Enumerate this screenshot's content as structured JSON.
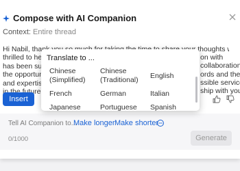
{
  "header": {
    "title": "Compose with AI Companion",
    "sparkle_icon": "sparkle-icon",
    "close_icon": "close-icon"
  },
  "context": {
    "label": "Context:",
    "value": "Entire thread"
  },
  "message": {
    "line1": "Hi Nabil, thank you so much for taking the time to share your thoughts with me. I'm",
    "line2_left": "thrilled to hea",
    "line3_left": "has been such",
    "line4_left": "the opportunity to",
    "line5_left": "and expertise,",
    "line6_left": "in the future!",
    "line2_right": "on with",
    "line3_right": "collaboration",
    "line4_right": "ords and the",
    "line5_right": "ssible service",
    "line6_right": "ship with you"
  },
  "actions": {
    "insert_label": "Insert",
    "thumbs_up_icon": "thumbs-up-icon",
    "thumbs_down_icon": "thumbs-down-icon"
  },
  "ai_prompt": {
    "placeholder": "Tell AI Companion to...",
    "make_longer": "Make longer",
    "make_shorter": "Make shorter",
    "refresh_icon": "refresh-icon",
    "counter": "0/1000",
    "generate_label": "Generate"
  },
  "translate_menu": {
    "title": "Translate to ...",
    "languages": [
      {
        "line1": "Chinese",
        "line2": "(Simplified)"
      },
      {
        "line1": "Chinese",
        "line2": "(Traditional)"
      },
      {
        "line1": "English",
        "line2": ""
      },
      {
        "line1": "French",
        "line2": ""
      },
      {
        "line1": "German",
        "line2": ""
      },
      {
        "line1": "Italian",
        "line2": ""
      },
      {
        "line1": "Japanese",
        "line2": ""
      },
      {
        "line1": "Portuguese",
        "line2": ""
      },
      {
        "line1": "Spanish",
        "line2": ""
      }
    ]
  },
  "colors": {
    "accent": "#1a62d4",
    "sparkle": "#1a62d4"
  }
}
